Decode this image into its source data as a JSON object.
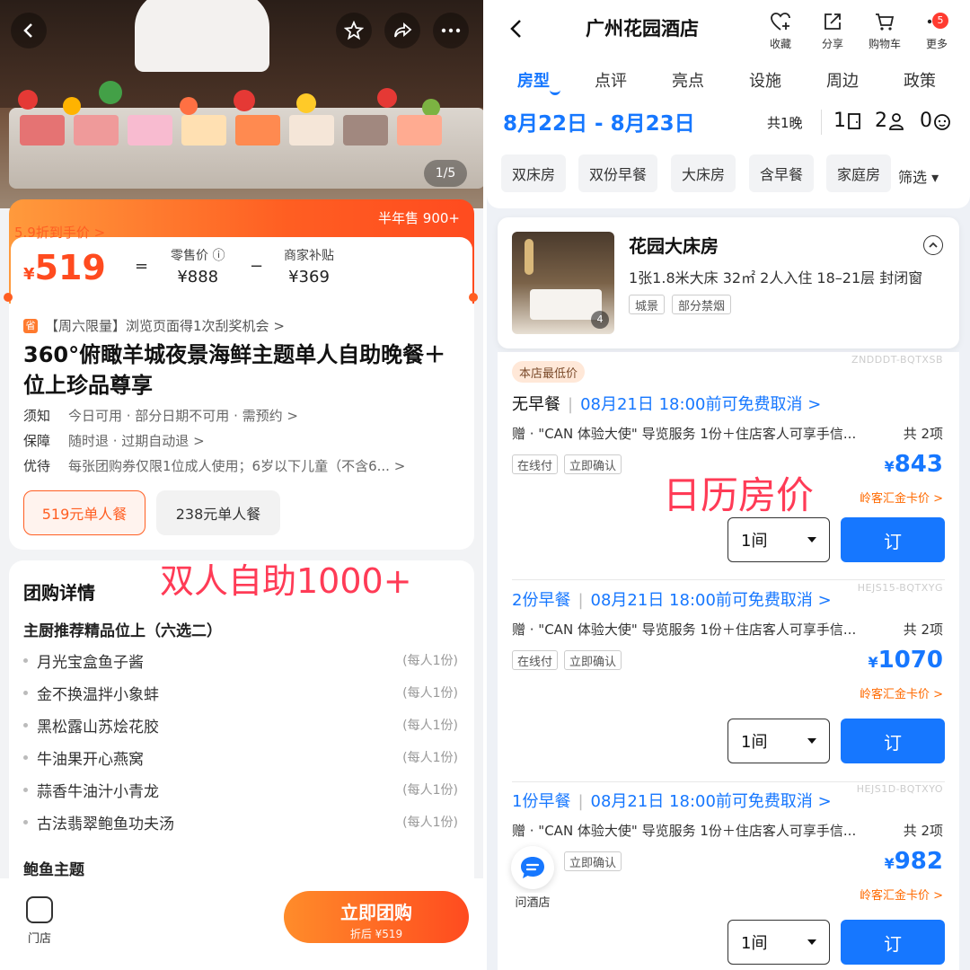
{
  "left": {
    "hero": {
      "counter": "1/5"
    },
    "price": {
      "discount_tag": "5.9折到手价 >",
      "currency": "¥",
      "main_price": "519",
      "equals": "=",
      "minus": "−",
      "half_year_sales": "半年售 900+",
      "retail_label": "零售价 ⓘ",
      "retail_value": "¥888",
      "subsidy_label": "商家补贴",
      "subsidy_value": "¥369"
    },
    "promo": {
      "icon": "省",
      "text": "【周六限量】浏览页面得1次刮奖机会 >"
    },
    "title": "360°俯瞰羊城夜景海鲜主题单人自助晚餐＋位上珍品尊享",
    "meta": [
      {
        "key": "须知",
        "value": "今日可用 · 部分日期不可用 · 需预约 >"
      },
      {
        "key": "保障",
        "value": "随时退 · 过期自动退 >"
      },
      {
        "key": "优待",
        "value": "每张团购券仅限1位成人使用；6岁以下儿童（不含6... >"
      }
    ],
    "packages": [
      "519元单人餐",
      "238元单人餐"
    ],
    "detail": {
      "title": "团购详情",
      "overlay": "双人自助1000+",
      "section1": "主厨推荐精品位上（六选二）",
      "dishes": [
        {
          "name": "月光宝盒鱼子酱",
          "portion": "(每人1份)"
        },
        {
          "name": "金不换温拌小象蚌",
          "portion": "(每人1份)"
        },
        {
          "name": "黑松露山苏烩花胶",
          "portion": "(每人1份)"
        },
        {
          "name": "牛油果开心燕窝",
          "portion": "(每人1份)"
        },
        {
          "name": "蒜香牛油汁小青龙",
          "portion": "(每人1份)"
        },
        {
          "name": "古法翡翠鲍鱼功夫汤",
          "portion": "(每人1份)"
        }
      ],
      "section2": "鲍鱼主题"
    },
    "bottom": {
      "store": "门店",
      "buy": "立即团购",
      "buy_sub": "折后 ¥519"
    }
  },
  "right": {
    "header": {
      "hotel_name": "广州花园酒店",
      "icons": [
        {
          "label": "收藏",
          "icon": "heart-plus-icon"
        },
        {
          "label": "分享",
          "icon": "share-icon"
        },
        {
          "label": "购物车",
          "icon": "cart-icon"
        },
        {
          "label": "更多",
          "icon": "more-icon"
        }
      ],
      "more_badge": "5"
    },
    "tabs": [
      "房型",
      "点评",
      "亮点",
      "设施",
      "周边",
      "政策"
    ],
    "dates": "8月22日 - 8月23日",
    "nights": "共1晚",
    "rooms_count": "1",
    "adults_count": "2",
    "children_count": "0",
    "chips": [
      "双床房",
      "双份早餐",
      "大床房",
      "含早餐",
      "家庭房"
    ],
    "filter": "筛选 ▾",
    "room": {
      "name": "花园大床房",
      "desc": "1张1.8米大床  32㎡  2人入住  18–21层  封闭窗",
      "tags": [
        "城景",
        "部分禁烟"
      ],
      "photo_count": "4"
    },
    "overlay": "日历房价",
    "offers": [
      {
        "code": "ZNDDDT-BQTXSB",
        "lowest": "本店最低价",
        "breakfast": "无早餐",
        "cancel": "08月21日 18:00前可免费取消 >",
        "gift": "赠 · \"CAN 体验大使\" 导览服务 1份＋住店客人可享手信...",
        "gift_count": "共 2项",
        "tags": [
          "在线付",
          "立即确认"
        ],
        "currency": "¥",
        "price": "843",
        "member": "岭客汇金卡价 >",
        "qty": "1间",
        "book": "订"
      },
      {
        "code": "HEJS15-BQTXYG",
        "lowest": "",
        "breakfast": "2份早餐",
        "cancel": "08月21日 18:00前可免费取消 >",
        "gift": "赠 · \"CAN 体验大使\" 导览服务 1份＋住店客人可享手信...",
        "gift_count": "共 2项",
        "tags": [
          "在线付",
          "立即确认"
        ],
        "currency": "¥",
        "price": "1070",
        "member": "岭客汇金卡价 >",
        "qty": "1间",
        "book": "订"
      },
      {
        "code": "HEJS1D-BQTXYO",
        "lowest": "",
        "breakfast": "1份早餐",
        "cancel": "08月21日 18:00前可免费取消 >",
        "gift": "赠 · \"CAN 体验大使\" 导览服务 1份＋住店客人可享手信...",
        "gift_count": "共 2项",
        "tags": [
          "",
          "立即确认"
        ],
        "currency": "¥",
        "price": "982",
        "member": "岭客汇金卡价 >",
        "qty": "1间",
        "book": "订"
      }
    ],
    "ask_hotel": "问酒店"
  }
}
